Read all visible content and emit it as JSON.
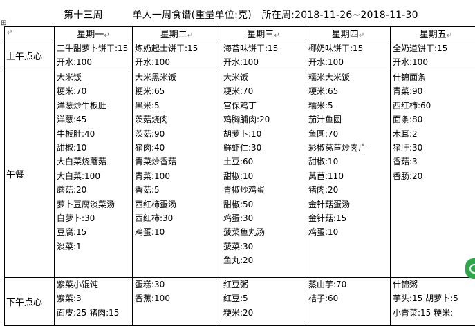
{
  "title": {
    "week": "第十三周",
    "heading": "单人一周食谱(重量单位:克)",
    "period": "所在周:2018-11-26~2018-11-30"
  },
  "header": {
    "corner": "↵",
    "days": [
      "星期一",
      "星期二",
      "星期三",
      "星期四",
      "星期五"
    ]
  },
  "meals": [
    {
      "label": "上午点心",
      "days": [
        [
          "三牛甜萝卜饼干:15",
          "开水:100"
        ],
        [
          "炼奶起士饼干:15",
          "开水:100"
        ],
        [
          "海苔味饼干:15",
          "开水:100"
        ],
        [
          "椰奶味饼干:15",
          "开水:100"
        ],
        [
          "全奶道饼干:15",
          "开水:100"
        ]
      ]
    },
    {
      "label": "午餐",
      "days": [
        [
          "大米饭",
          "粳米:70",
          "洋葱炒牛板肚",
          "洋葱:45",
          "牛板肚:40",
          "甜椒:10",
          "大白菜烧蘑菇",
          "大白菜:100",
          "蘑菇:20",
          "萝卜豆腐淡菜汤",
          "白萝卜:30",
          "豆腐:15",
          "淡菜:1"
        ],
        [
          "大米黑米饭",
          "粳米:65",
          "黑米:5",
          "茨菇烧肉",
          "茨菇:90",
          "猪肉:40",
          "青菜炒香菇",
          "青菜:100",
          "香菇:5",
          "西红柿蛋汤",
          "西红柿:30",
          "鸡蛋:10"
        ],
        [
          "大米饭",
          "粳米:70",
          "宫保鸡丁",
          "鸡胸脯肉:20",
          "胡萝卜:10",
          "鲜虾仁:30",
          "土豆:60",
          "甜椒:10",
          "青椒炒鸡蛋",
          "甜椒:50",
          "鸡蛋:30",
          "菠菜鱼丸汤",
          "菠菜:30",
          "鱼丸:20"
        ],
        [
          "糯米大米饭",
          "粳米:65",
          "糯米:5",
          "茄汁鱼圆",
          "鱼圆:70",
          "彩椒莴苣炒肉片",
          "甜椒:10",
          "莴苣:110",
          "猪肉:20",
          "金针菇蛋汤",
          "金针菇:15",
          "鸡蛋:10"
        ],
        [
          "什锦面条",
          "青菜:90",
          "西红柿:60",
          "面条:80",
          "木耳:2",
          "猪肝:30",
          "香菇:3",
          "香肠:20"
        ]
      ]
    },
    {
      "label": "下午点心",
      "days": [
        [
          "紫菜小馄饨",
          "紫菜:3",
          "面皮:25 猪肉:15"
        ],
        [
          "蛋糕:30",
          "香蕉:100"
        ],
        [
          "红豆粥",
          "红豆:5",
          "粳米:20"
        ],
        [
          "蒸山芋:70",
          "桔子:60"
        ],
        [
          "什锦粥",
          "芋头:15 胡萝卜:5",
          "小青菜:15 粳米:"
        ]
      ]
    }
  ]
}
